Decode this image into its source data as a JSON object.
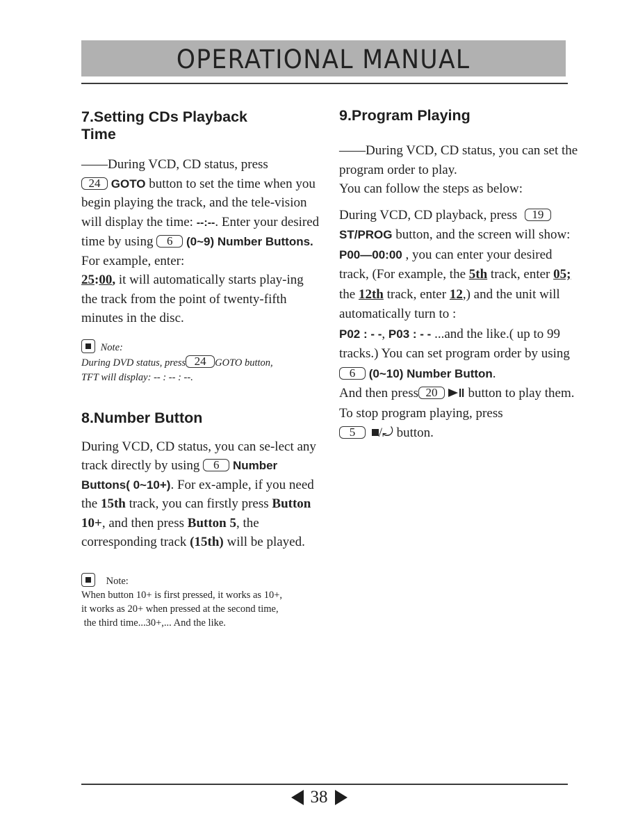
{
  "header": {
    "title": "OPERATIONAL MANUAL",
    "background_color": "#b1b1b1"
  },
  "footer": {
    "prev_icon": "triangle-left-icon",
    "page_number": "38",
    "next_icon": "triangle-right-icon"
  },
  "section7": {
    "title_line1": "7.Setting CDs Playback",
    "title_line2": "Time",
    "p1_dash": "——",
    "p1_a": "During VCD, CD status, press",
    "btn_goto": "24",
    "goto_label": "GOTO",
    "p1_b": " button to set the time when you begin playing the track, and the tele-vision will display the time: ",
    "time_display": "--:--",
    "p1_c": ". Enter your desired time by using ",
    "btn_number": "6",
    "range": "(0~9)",
    "number_buttons": "Number Buttons.",
    "p1_d": " For example, enter: ",
    "ex_min": "25",
    "ex_colon": ":",
    "ex_sec": "00",
    "ex_comma": ",",
    "p1_e": "  it will automatically starts play-ing the track from the point of twenty-fifth minutes in the disc.",
    "note": {
      "label": "Note:",
      "text_a": "During DVD status, press",
      "btn": "24",
      "text_b": "GOTO button,",
      "text_c": "TFT will display:  -- : -- : --."
    }
  },
  "section8": {
    "title": "8.Number Button",
    "p_a": "During VCD, CD status, you can se-lect any track directly by using ",
    "btn_number": "6",
    "number_buttons": "Number Buttons( 0~10+)",
    "p_b": ". For ex-ample, if you need the ",
    "track15": "15th",
    "p_c": " track, you can firstly press ",
    "button10": "Button 10+",
    "p_d": ", and then press ",
    "button5": "Button 5",
    "p_e": ", the corresponding track ",
    "track15_paren": "(15th)",
    "p_f": " will be played.",
    "note": {
      "label": "Note:",
      "line1": "When button 10+ is first pressed, it works as 10+,",
      "line2": "it works as 20+ when pressed at the second time,",
      "line3": " the third time...30+,... And the like."
    }
  },
  "section9": {
    "title": "9.Program Playing",
    "intro_dash": "——",
    "intro_a": "During VCD, CD status,  you can set the program order to play.",
    "intro_b": "You can follow the steps as below:",
    "p_a": "During VCD, CD playback, press ",
    "btn_prog": "19",
    "stprog": "ST/PROG",
    "p_b": " button, and the screen will show: ",
    "screen_display": "P00—00:00",
    "p_c": " , you can enter your desired track, (For example, the ",
    "ex5th": "5th",
    "p_d": " track, enter ",
    "ex05": "05;",
    "p_e": " the ",
    "ex12th": "12th",
    "p_f": " track, enter ",
    "ex12": "12",
    "p_g": ",) and the unit will automatically turn to :",
    "p02": "P02 : - -",
    "p_comma": ", ",
    "p03": "P03 : - -",
    "p_h": "  ...and the like.( up to 99 tracks.) You can set program order by using ",
    "btn_number": "6",
    "number_button": "(0~10) Number Button",
    "p_i": ".",
    "p_j": "And then press",
    "btn_play": "20",
    "play_icon": "play-pause-icon",
    "p_k": " button to play them. To stop program playing, press",
    "btn_stop": "5",
    "stop_icon": "stop-return-icon",
    "p_l": " button."
  }
}
